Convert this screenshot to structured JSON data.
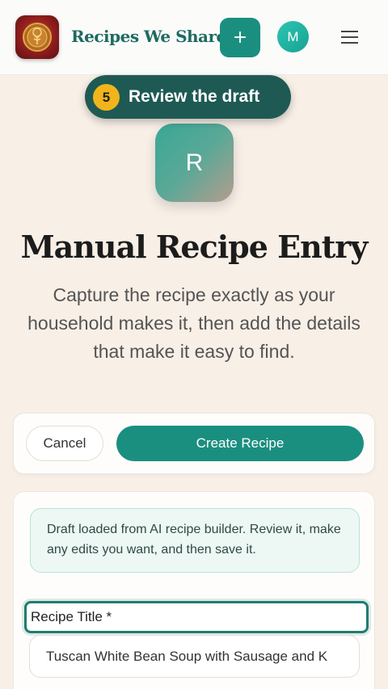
{
  "header": {
    "brand": "Recipes We Share",
    "add_icon": "plus-icon",
    "add_symbol": "+",
    "avatar_initial": "M",
    "menu_icon": "hamburger-icon"
  },
  "step": {
    "number": "5",
    "label": "Review the draft"
  },
  "hero": {
    "icon_letter": "R",
    "title": "Manual Recipe Entry",
    "subtitle": "Capture the recipe exactly as your household makes it, then add the details that make it easy to find."
  },
  "actions": {
    "cancel_label": "Cancel",
    "create_label": "Create Recipe"
  },
  "form": {
    "notice": "Draft loaded from AI recipe builder. Review it, make any edits you want, and then save it.",
    "title_label": "Recipe Title *",
    "title_value": "Tuscan White Bean Soup with Sausage and K"
  },
  "colors": {
    "accent": "#1a8f80",
    "step_bg": "#1e5a53",
    "step_badge": "#f1b51b",
    "background": "#f8efe7"
  }
}
